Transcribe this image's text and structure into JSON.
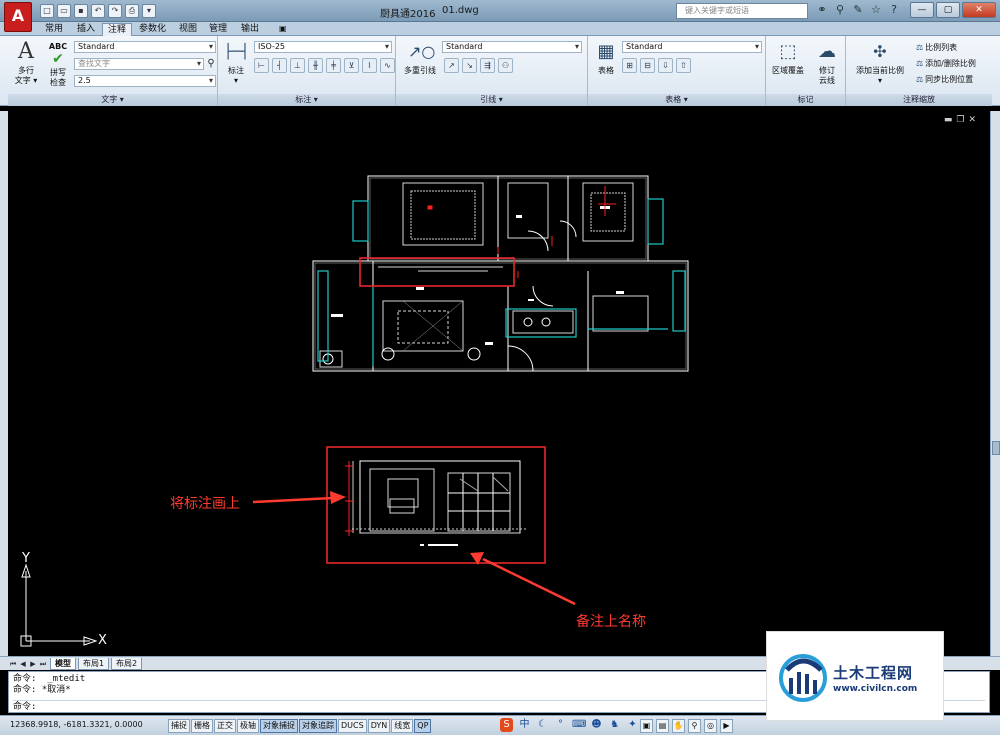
{
  "title": {
    "app": "厨具通2016",
    "file": "01.dwg"
  },
  "search": {
    "placeholder": "键入关键字或短语"
  },
  "ribbon_tabs": [
    "常用",
    "插入",
    "注释",
    "参数化",
    "视图",
    "管理",
    "输出",
    "▣"
  ],
  "ribbon_active_tab": "注释",
  "panels": {
    "text": {
      "title": "文字 ▾",
      "multiline_label_1": "多行",
      "multiline_label_2": "文字 ▾",
      "spell_label_1": "拼写",
      "spell_label_2": "检查",
      "abc": "ABC",
      "style": "Standard",
      "find_placeholder": "查找文字",
      "height": "2.5"
    },
    "dimension": {
      "title": "标注 ▾",
      "button_label": "标注",
      "style": "ISO-25"
    },
    "leader": {
      "title": "引线 ▾",
      "button_label": "多重引线",
      "style": "Standard"
    },
    "table": {
      "title": "表格 ▾",
      "button_label": "表格",
      "style": "Standard"
    },
    "markup": {
      "title": "标记",
      "wipeout_label": "区域覆盖",
      "revcloud_label_1": "修订",
      "revcloud_label_2": "云线"
    },
    "scale": {
      "title": "注释缩放",
      "add_current_label": "添加当前比例",
      "scale_list": "比例列表",
      "add_delete": "添加/删除比例",
      "sync": "同步比例位置"
    }
  },
  "annotations": {
    "label_1": "将标注画上",
    "label_2": "备注上名称"
  },
  "ucs": {
    "y": "Y",
    "x": "X"
  },
  "layout_tabs": [
    "模型",
    "布局1",
    "布局2"
  ],
  "command_history": [
    "命令:  _mtedit",
    "命令: *取消*"
  ],
  "command_prompt": "命令:",
  "coords": "12368.9918,  -6181.3321,  0.0000",
  "status_toggles": [
    {
      "label": "捕捉",
      "on": false
    },
    {
      "label": "栅格",
      "on": false
    },
    {
      "label": "正交",
      "on": false
    },
    {
      "label": "极轴",
      "on": false
    },
    {
      "label": "对象捕捉",
      "on": true
    },
    {
      "label": "对象追踪",
      "on": true
    },
    {
      "label": "DUCS",
      "on": false
    },
    {
      "label": "DYN",
      "on": false
    },
    {
      "label": "线宽",
      "on": false
    },
    {
      "label": "QP",
      "on": true
    }
  ],
  "ime": {
    "lang": "中"
  },
  "colors": {
    "annotation_red": "#ff3b30",
    "highlight_box": "#e8282a",
    "cad_wall": "#ffffff",
    "cad_cyan": "#1fc8c8"
  },
  "watermark": {
    "brand": "土木工程网",
    "url": "www.civilcn.com"
  }
}
